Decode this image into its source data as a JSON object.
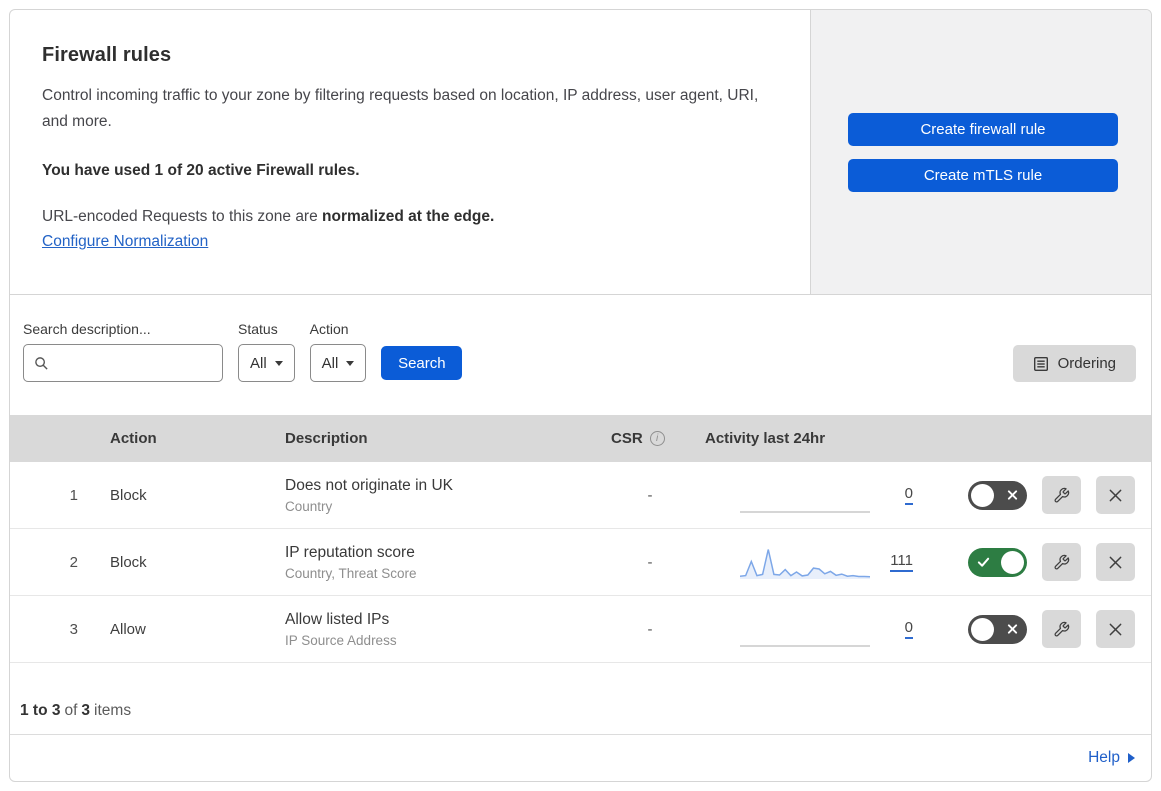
{
  "header": {
    "title": "Firewall rules",
    "description": "Control incoming traffic to your zone by filtering requests based on location, IP address, user agent, URI, and more.",
    "usage": "You have used 1 of 20 active Firewall rules.",
    "normalization_text": "URL-encoded Requests to this zone are",
    "normalization_bold": "normalized at the edge.",
    "normalization_link": "Configure Normalization",
    "create_firewall_button": "Create firewall rule",
    "create_mtls_button": "Create mTLS rule"
  },
  "filters": {
    "search_label": "Search description...",
    "status_label": "Status",
    "status_value": "All",
    "action_label": "Action",
    "action_value": "All",
    "search_button": "Search",
    "ordering_button": "Ordering"
  },
  "table": {
    "columns": {
      "action": "Action",
      "description": "Description",
      "csr": "CSR",
      "activity": "Activity last 24hr"
    },
    "info_icon_glyph": "i",
    "rows": [
      {
        "num": "1",
        "action": "Block",
        "description": "Does not originate in UK",
        "fields": "Country",
        "csr": "-",
        "activity": "0",
        "enabled": false,
        "sparkline": null
      },
      {
        "num": "2",
        "action": "Block",
        "description": "IP reputation score",
        "fields": "Country, Threat Score",
        "csr": "-",
        "activity": "111",
        "enabled": true,
        "sparkline": [
          6,
          8,
          55,
          8,
          12,
          95,
          12,
          10,
          28,
          8,
          20,
          7,
          10,
          33,
          30,
          14,
          22,
          9,
          13,
          6,
          8,
          5,
          5,
          4
        ]
      },
      {
        "num": "3",
        "action": "Allow",
        "description": "Allow listed IPs",
        "fields": "IP Source Address",
        "csr": "-",
        "activity": "0",
        "enabled": false,
        "sparkline": null
      }
    ]
  },
  "footer": {
    "range": "1 to 3",
    "of": "of",
    "total": "3",
    "items": "items",
    "help": "Help"
  },
  "colors": {
    "primary_blue": "#0b5cd7",
    "link_blue": "#2363c6",
    "toggle_on_green": "#2d7d43",
    "toggle_off_gray": "#4c4c4c",
    "sparkline_stroke": "#7da7e8",
    "sparkline_fill": "rgba(125,167,232,0.18)",
    "baseline_gray": "#c9c9c9"
  }
}
